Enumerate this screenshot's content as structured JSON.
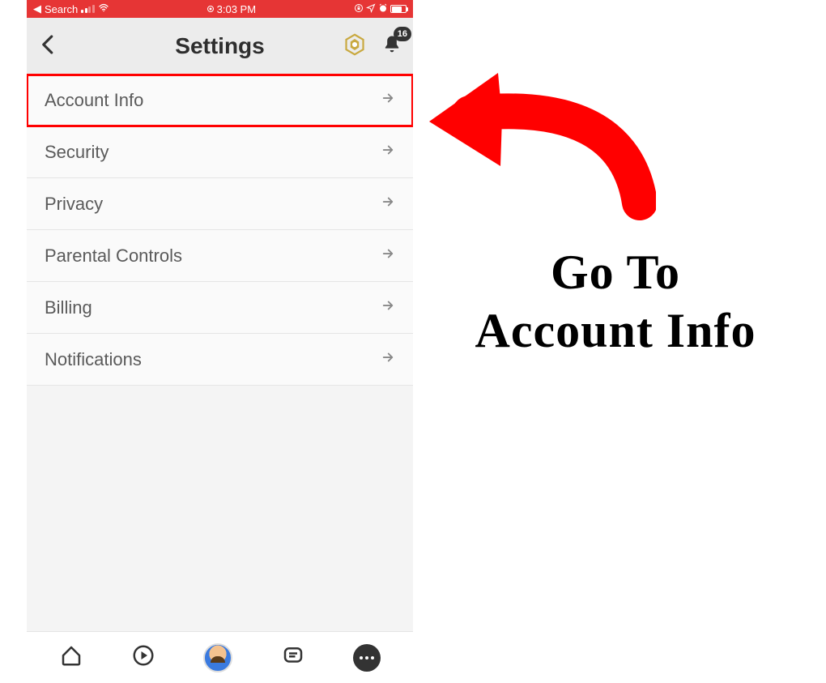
{
  "status_bar": {
    "back_app": "Search",
    "time": "3:03 PM"
  },
  "header": {
    "title": "Settings",
    "notification_count": "16"
  },
  "settings": {
    "rows": [
      {
        "label": "Account Info",
        "highlighted": true
      },
      {
        "label": "Security"
      },
      {
        "label": "Privacy"
      },
      {
        "label": "Parental Controls"
      },
      {
        "label": "Billing"
      },
      {
        "label": "Notifications"
      }
    ]
  },
  "annotation": {
    "line1": "Go To",
    "line2": "Account Info"
  },
  "colors": {
    "highlight": "#ff0000",
    "status_bar_bg": "#e63535"
  }
}
